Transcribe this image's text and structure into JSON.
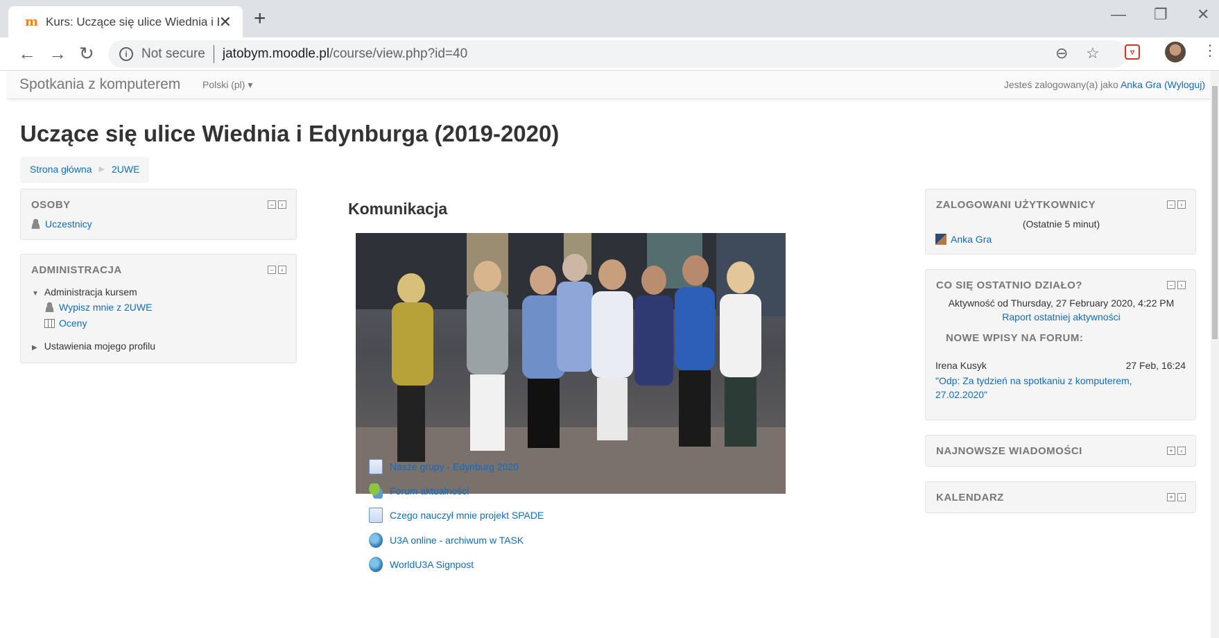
{
  "browser": {
    "tab_title": "Kurs: Uczące się ulice Wiednia i E",
    "tab_favicon": "m",
    "not_secure": "Not secure",
    "url_host": "jatobym.moodle.pl",
    "url_path": "/course/view.php?id=40"
  },
  "navbar": {
    "brand": "Spotkania z komputerem",
    "language": "Polski (pl) ▾",
    "logged_prefix": "Jesteś zalogowany(a) jako ",
    "user_name": "Anka Gra",
    "logout_open": " (",
    "logout": "Wyloguj",
    "logout_close": ")"
  },
  "page_title": "Uczące się ulice Wiednia i Edynburga (2019-2020)",
  "breadcrumb": [
    "Strona główna",
    "2UWE"
  ],
  "blocks_left": {
    "osoby": {
      "title": "OSOBY",
      "item": "Uczestnicy"
    },
    "admin": {
      "title": "ADMINISTRACJA",
      "course_admin": "Administracja kursem",
      "unenrol": "Wypisz mnie z 2UWE",
      "grades": "Oceny",
      "profile_settings": "Ustawienia mojego profilu"
    }
  },
  "center": {
    "section_title": "Komunikacja",
    "activities": [
      {
        "label": "Nasze grupy - Edynburg 2020",
        "icon": "page-icon"
      },
      {
        "label": "Forum aktualności",
        "icon": "forum-icon"
      },
      {
        "label": "Czego nauczył mnie projekt SPADE",
        "icon": "page-icon"
      },
      {
        "label": "U3A online - archiwum w TASK",
        "icon": "url-icon"
      },
      {
        "label": "WorldU3A Signpost",
        "icon": "url-icon"
      }
    ]
  },
  "blocks_right": {
    "online": {
      "title": "ZALOGOWANI UŻYTKOWNICY",
      "subtitle": "(Ostatnie 5 minut)",
      "user": "Anka Gra"
    },
    "recent": {
      "title": "CO SIĘ OSTATNIO DZIAŁO?",
      "since": "Aktywność od Thursday, 27 February 2020, 4:22 PM",
      "report_link": "Raport ostatniej aktywności",
      "forum_heading": "NOWE WPISY NA FORUM:",
      "post_author": "Irena Kusyk",
      "post_date": "27 Feb, 16:24",
      "post_link_line1": "Odp: Za tydzień na spotkaniu z komputerem,",
      "post_link_line2": "27.02.2020"
    },
    "news": {
      "title": "NAJNOWSZE WIADOMOŚCI"
    },
    "calendar": {
      "title": "KALENDARZ"
    }
  },
  "colors": {
    "link": "#0f6cbf",
    "block_bg": "#f5f5f5",
    "moodle_orange": "#f98012"
  }
}
